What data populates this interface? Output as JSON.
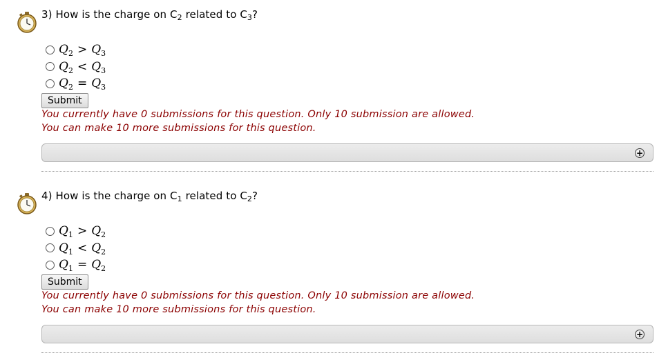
{
  "questions": [
    {
      "number": "3)",
      "prefix": "How is the charge on C",
      "sub1": "2",
      "middle": " related to C",
      "sub2": "3",
      "suffix": "?",
      "options": [
        {
          "left": "Q",
          "left_sub": "2",
          "rel": ">",
          "right": "Q",
          "right_sub": "3"
        },
        {
          "left": "Q",
          "left_sub": "2",
          "rel": "<",
          "right": "Q",
          "right_sub": "3"
        },
        {
          "left": "Q",
          "left_sub": "2",
          "rel": "=",
          "right": "Q",
          "right_sub": "3"
        }
      ],
      "submit_label": "Submit",
      "msg_line1": "You currently have 0 submissions for this question. Only 10 submission are allowed.",
      "msg_line2": "You can make 10 more submissions for this question.",
      "expand_symbol": "+"
    },
    {
      "number": "4)",
      "prefix": "How is the charge on C",
      "sub1": "1",
      "middle": " related to C",
      "sub2": "2",
      "suffix": "?",
      "options": [
        {
          "left": "Q",
          "left_sub": "1",
          "rel": ">",
          "right": "Q",
          "right_sub": "2"
        },
        {
          "left": "Q",
          "left_sub": "1",
          "rel": "<",
          "right": "Q",
          "right_sub": "2"
        },
        {
          "left": "Q",
          "left_sub": "1",
          "rel": "=",
          "right": "Q",
          "right_sub": "2"
        }
      ],
      "submit_label": "Submit",
      "msg_line1": "You currently have 0 submissions for this question. Only 10 submission are allowed.",
      "msg_line2": "You can make 10 more submissions for this question.",
      "expand_symbol": "+"
    }
  ],
  "icons": {
    "timer": "stopwatch-icon",
    "expand": "plus-circle-icon"
  },
  "colors": {
    "message": "#8b0000",
    "bar": "#e4e4e4"
  }
}
